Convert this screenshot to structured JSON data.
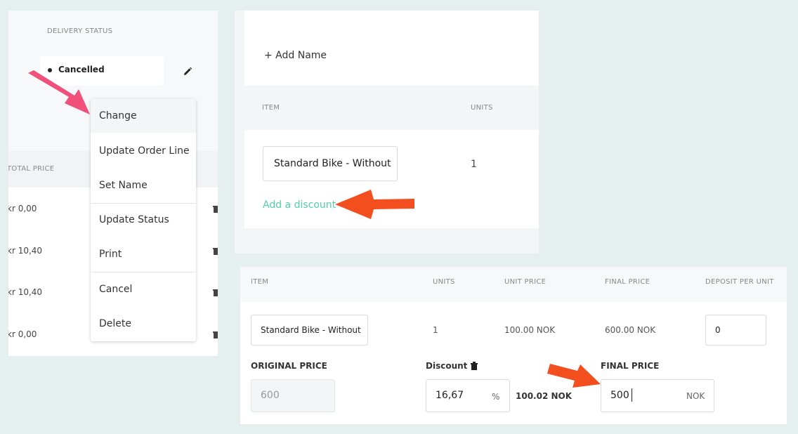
{
  "order_panel": {
    "delivery_status_header": "DELIVERY STATUS",
    "status_value": "Cancelled",
    "total_price_header": "TOTAL PRICE",
    "rows": [
      {
        "total_price": "kr 0,00"
      },
      {
        "total_price": "kr 10,40"
      },
      {
        "total_price": "kr 10,40"
      },
      {
        "total_price": "kr 0,00"
      }
    ],
    "context_menu": [
      {
        "label": "Change"
      },
      {
        "label": "Update Order Line"
      },
      {
        "label": "Set Name"
      },
      {
        "label": "Update Status"
      },
      {
        "label": "Print"
      },
      {
        "label": "Cancel"
      },
      {
        "label": "Delete"
      }
    ]
  },
  "line_panel": {
    "add_name_label": "+ Add Name",
    "headers": {
      "item": "ITEM",
      "units": "UNITS"
    },
    "item_value": "Standard Bike - Without",
    "units_value": "1",
    "add_discount_label": "Add a discount"
  },
  "discount_panel": {
    "headers": {
      "item": "ITEM",
      "units": "UNITS",
      "unit_price": "UNIT PRICE",
      "final_price": "FINAL PRICE",
      "deposit_per_unit": "DEPOSIT PER UNIT"
    },
    "row": {
      "item": "Standard Bike - Without",
      "units": "1",
      "unit_price": "100.00 NOK",
      "final_price": "600.00 NOK",
      "deposit": "0"
    },
    "original_price_label": "ORIGINAL PRICE",
    "original_price_value": "600",
    "discount_label": "Discount",
    "discount_value": "16,67",
    "discount_unit": "%",
    "discount_amount": "100.02 NOK",
    "final_price_label": "FINAL PRICE",
    "final_price_value": "500",
    "final_price_unit": "NOK"
  },
  "colors": {
    "background": "#e4efee",
    "accent_green": "#4fd1a5",
    "arrow_pink": "#f0507a",
    "arrow_orange": "#f24e1e"
  }
}
